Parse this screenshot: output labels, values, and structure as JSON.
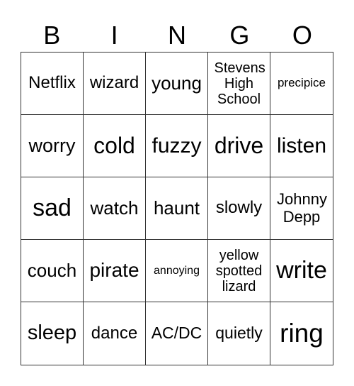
{
  "title_letters": [
    "B",
    "I",
    "N",
    "G",
    "O"
  ],
  "cells": [
    {
      "text": "Netflix",
      "size": 24
    },
    {
      "text": "wizard",
      "size": 24
    },
    {
      "text": "young",
      "size": 26
    },
    {
      "text": "Stevens High School",
      "size": 20
    },
    {
      "text": "precipice",
      "size": 17
    },
    {
      "text": "worry",
      "size": 27
    },
    {
      "text": "cold",
      "size": 32
    },
    {
      "text": "fuzzy",
      "size": 30
    },
    {
      "text": "drive",
      "size": 32
    },
    {
      "text": "listen",
      "size": 30
    },
    {
      "text": "sad",
      "size": 34
    },
    {
      "text": "watch",
      "size": 26
    },
    {
      "text": "haunt",
      "size": 26
    },
    {
      "text": "slowly",
      "size": 24
    },
    {
      "text": "Johnny Depp",
      "size": 22
    },
    {
      "text": "couch",
      "size": 26
    },
    {
      "text": "pirate",
      "size": 28
    },
    {
      "text": "annoying",
      "size": 16
    },
    {
      "text": "yellow spotted lizard",
      "size": 20
    },
    {
      "text": "write",
      "size": 34
    },
    {
      "text": "sleep",
      "size": 29
    },
    {
      "text": "dance",
      "size": 24
    },
    {
      "text": "AC/DC",
      "size": 23
    },
    {
      "text": "quietly",
      "size": 23
    },
    {
      "text": "ring",
      "size": 37
    }
  ]
}
